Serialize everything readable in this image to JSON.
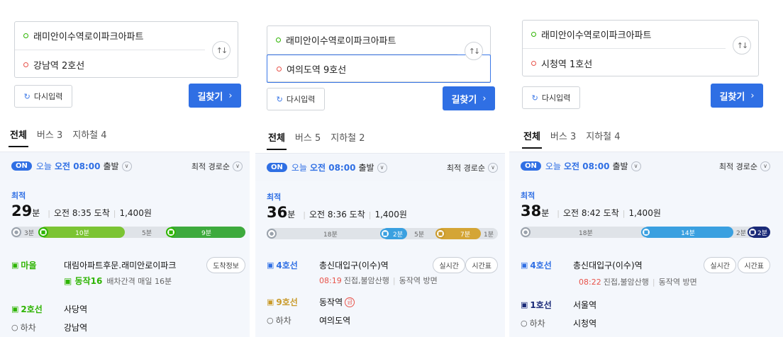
{
  "colors": {
    "accent": "#2f6fe4",
    "bus_green": "#2db400",
    "line2_green": "#2db400",
    "line4_blue": "#3aa0e0",
    "line9_gold": "#c99a2a",
    "line1_navy": "#1a2a78",
    "red": "#e8534a",
    "timeline_bg": "#dfe3e8"
  },
  "panels": [
    {
      "origin": "래미안이수역로이파크아파트",
      "destination": "강남역 2호선",
      "reset_label": "다시입력",
      "search_label": "길찾기",
      "tabs": [
        "전체",
        "버스 3",
        "지하철 4"
      ],
      "on_badge": "ON",
      "today": "오늘",
      "time": "오전 08:00",
      "depart": "출발",
      "sort": "최적 경로순",
      "best": "최적",
      "duration": "29",
      "duration_unit": "분",
      "arrival": "오전 8:35 도착",
      "fare": "1,400원",
      "timeline": {
        "walk1": "3분",
        "bus": "10분",
        "walk2": "5분",
        "subway": "9분"
      },
      "steps": [
        {
          "mode": "마을",
          "station": "대림아파트후문.래미안로이파크",
          "pill": "도착정보",
          "route": "동작16",
          "route_info": "배차간격 매일 16분"
        },
        {
          "mode": "2호선",
          "station": "사당역"
        },
        {
          "mode": "하차",
          "station": "강남역"
        }
      ]
    },
    {
      "origin": "래미안이수역로이파크아파트",
      "destination": "여의도역 9호선",
      "reset_label": "다시입력",
      "search_label": "길찾기",
      "tabs": [
        "전체",
        "버스 5",
        "지하철 2"
      ],
      "on_badge": "ON",
      "today": "오늘",
      "time": "오전 08:00",
      "depart": "출발",
      "sort": "최적 경로순",
      "best": "최적",
      "duration": "36",
      "duration_unit": "분",
      "arrival": "오전 8:36 도착",
      "fare": "1,400원",
      "timeline": {
        "walk1": "18분",
        "sub1": "2분",
        "walk2": "5분",
        "sub2": "7분",
        "walk3": "1분"
      },
      "steps": [
        {
          "mode": "4호선",
          "station": "총신대입구(이수)역",
          "pill1": "실시간",
          "pill2": "시간표",
          "time": "08:19",
          "info": "진접,불암산행",
          "dir": "동작역 방면"
        },
        {
          "mode": "9호선",
          "station": "동작역",
          "badge": "급"
        },
        {
          "mode": "하차",
          "station": "여의도역"
        }
      ]
    },
    {
      "origin": "래미안이수역로이파크아파트",
      "destination": "시청역 1호선",
      "reset_label": "다시입력",
      "search_label": "길찾기",
      "tabs": [
        "전체",
        "버스 3",
        "지하철 4"
      ],
      "on_badge": "ON",
      "today": "오늘",
      "time": "오전 08:00",
      "depart": "출발",
      "sort": "최적 경로순",
      "best": "최적",
      "duration": "38",
      "duration_unit": "분",
      "arrival": "오전 8:42 도착",
      "fare": "1,400원",
      "timeline": {
        "walk1": "18분",
        "sub1": "14분",
        "walk2": "2분",
        "sub2": "2분"
      },
      "steps": [
        {
          "mode": "4호선",
          "station": "총신대입구(이수)역",
          "pill1": "실시간",
          "pill2": "시간표",
          "time": "08:22",
          "info": "진접,불암산행",
          "dir": "동작역 방면"
        },
        {
          "mode": "1호선",
          "station": "서울역"
        },
        {
          "mode": "하차",
          "station": "시청역"
        }
      ]
    }
  ]
}
